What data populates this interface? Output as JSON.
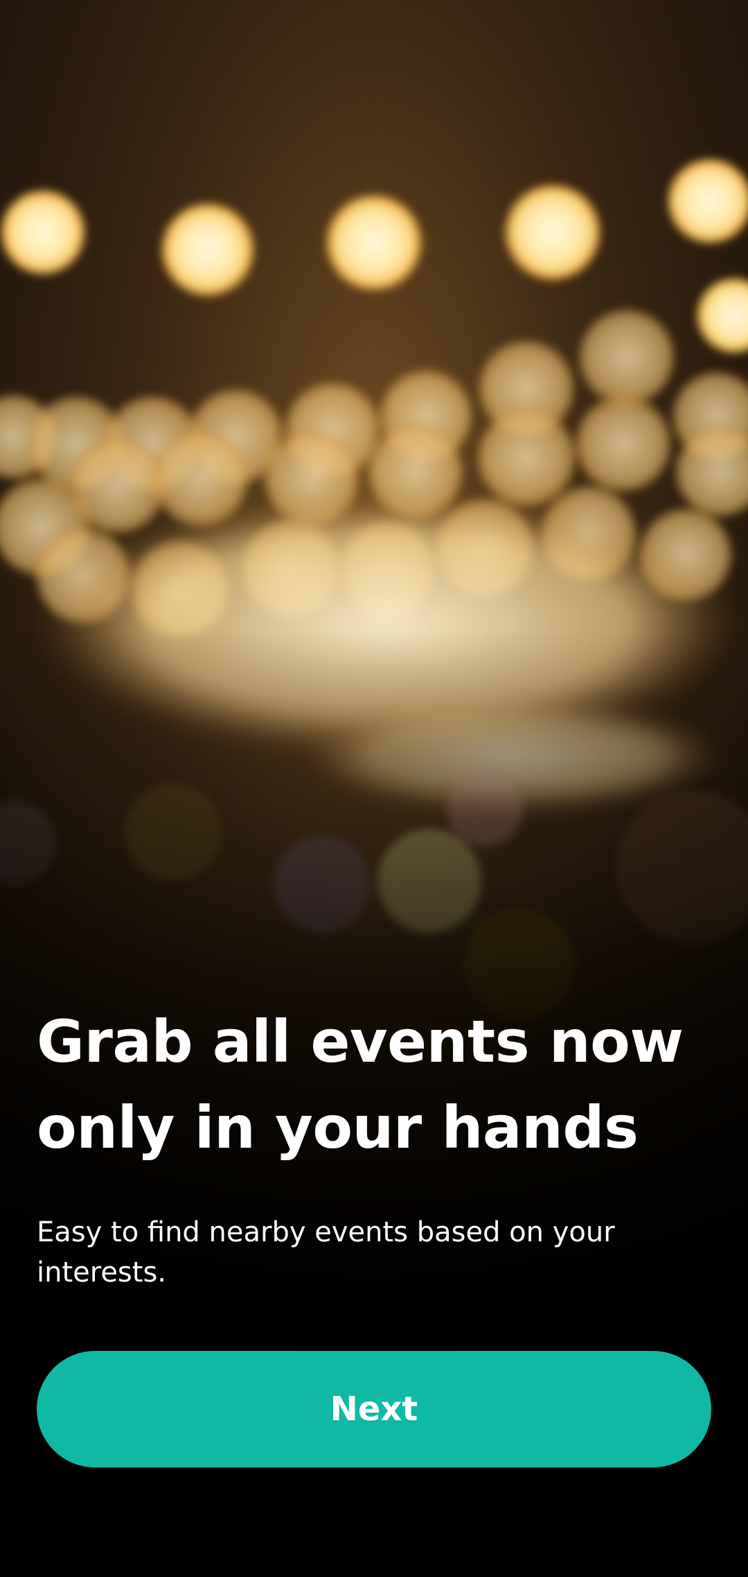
{
  "onboarding": {
    "headline": "Grab all events now only in your hands",
    "subtext": "Easy to find nearby events based on your interests.",
    "next_label": "Next"
  },
  "colors": {
    "accent": "#10b9a4",
    "text": "#ffffff",
    "background": "#000000"
  }
}
